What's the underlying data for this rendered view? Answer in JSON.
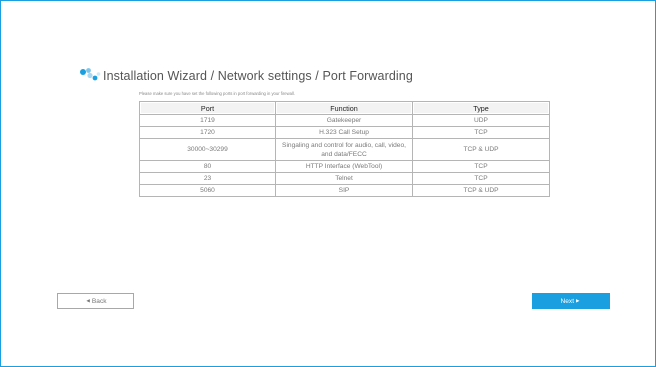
{
  "header": {
    "title": "Installation Wizard / Network settings / Port Forwarding",
    "note": "Please make sure you have set the following ports in port forwarding in your firewall."
  },
  "table": {
    "columns": [
      "Port",
      "Function",
      "Type"
    ],
    "rows": [
      {
        "port": "1719",
        "function": "Gatekeeper",
        "type": "UDP"
      },
      {
        "port": "1720",
        "function": "H.323 Call Setup",
        "type": "TCP"
      },
      {
        "port": "30000~30299",
        "function": "Singaling and control for audio, call, video, and data/FECC",
        "type": "TCP & UDP"
      },
      {
        "port": "80",
        "function": "HTTP Interface (WebTool)",
        "type": "TCP"
      },
      {
        "port": "23",
        "function": "Telnet",
        "type": "TCP"
      },
      {
        "port": "5060",
        "function": "SIP",
        "type": "TCP & UDP"
      }
    ]
  },
  "buttons": {
    "back_label": "Back",
    "next_label": "Next"
  },
  "icons": {
    "logo": "dots-logo-icon",
    "back_arrow": "left-triangle-icon",
    "next_arrow": "right-triangle-icon"
  },
  "colors": {
    "accent": "#1aa0e0",
    "logo_light": "#a9d8f2"
  }
}
